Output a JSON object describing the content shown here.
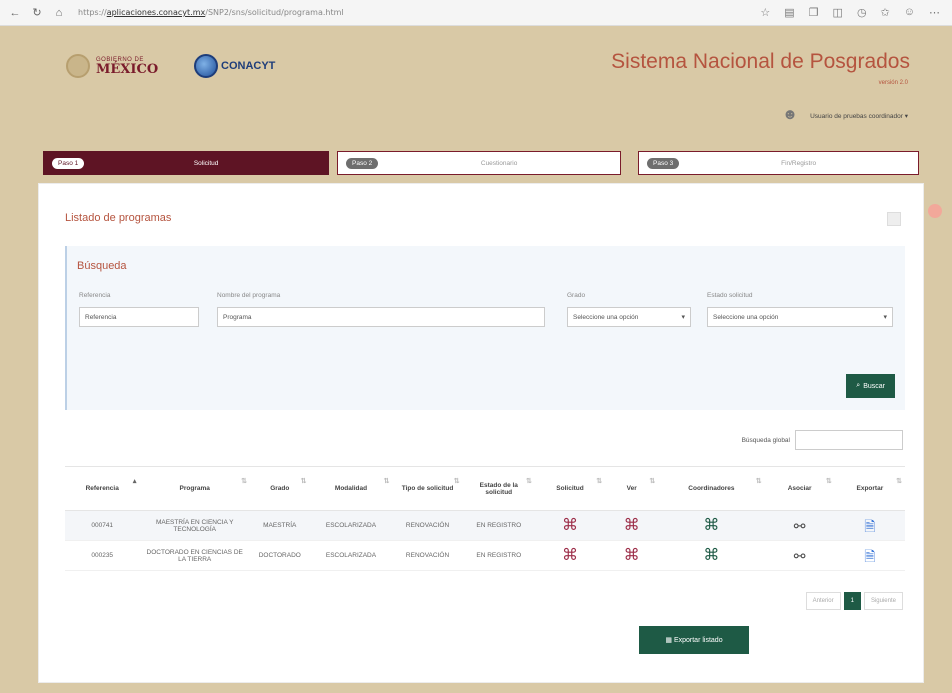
{
  "browser": {
    "url_prefix": "https://",
    "url_host": "aplicaciones.conacyt.mx",
    "url_rest": "/SNP2/sns/solicitud/programa.html"
  },
  "header": {
    "gob_small": "GOBIERNO DE",
    "gob_big": "MÉXICO",
    "conacyt": "CONACYT",
    "system_title": "Sistema Nacional de Posgrados",
    "system_sub": "versión 2.0",
    "user_name": "Usuario de pruebas coordinador ▾"
  },
  "steps": [
    {
      "pill": "Paso 1",
      "label": "Solicitud"
    },
    {
      "pill": "Paso 2",
      "label": "Cuestionario"
    },
    {
      "pill": "Paso 3",
      "label": "Fin/Registro"
    }
  ],
  "card": {
    "title": "Listado de programas"
  },
  "search": {
    "title": "Búsqueda",
    "fields": [
      {
        "label": "Referencia",
        "value": "Referencia"
      },
      {
        "label": "Nombre del programa",
        "value": "Programa"
      },
      {
        "label": "Grado",
        "value": "Seleccione una opción"
      },
      {
        "label": "Estado solicitud",
        "value": "Seleccione una opción"
      }
    ],
    "button": "Buscar"
  },
  "global_search": {
    "label": "Búsqueda global"
  },
  "table": {
    "columns": [
      "Referencia",
      "Programa",
      "Grado",
      "Modalidad",
      "Tipo de solicitud",
      "Estado de la solicitud",
      "Solicitud",
      "Ver",
      "Coordinadores",
      "Asociar",
      "Exportar"
    ],
    "rows": [
      {
        "ref": "000741",
        "programa": "MAESTRÍA EN CIENCIA Y TECNOLOGÍA",
        "grado": "MAESTRÍA",
        "modalidad": "ESCOLARIZADA",
        "tipo": "RENOVACIÓN",
        "estado": "EN REGISTRO"
      },
      {
        "ref": "000235",
        "programa": "DOCTORADO EN CIENCIAS DE LA TIERRA",
        "grado": "DOCTORADO",
        "modalidad": "ESCOLARIZADA",
        "tipo": "RENOVACIÓN",
        "estado": "EN REGISTRO"
      }
    ]
  },
  "pager": {
    "prev": "Anterior",
    "current": "1",
    "next": "Siguiente"
  },
  "export_button": "Exportar listado",
  "colors": {
    "brand_maroon": "#5e1424",
    "title_orange": "#b5543f",
    "action_green": "#1e5a45",
    "bino_red": "#9c2d48"
  }
}
